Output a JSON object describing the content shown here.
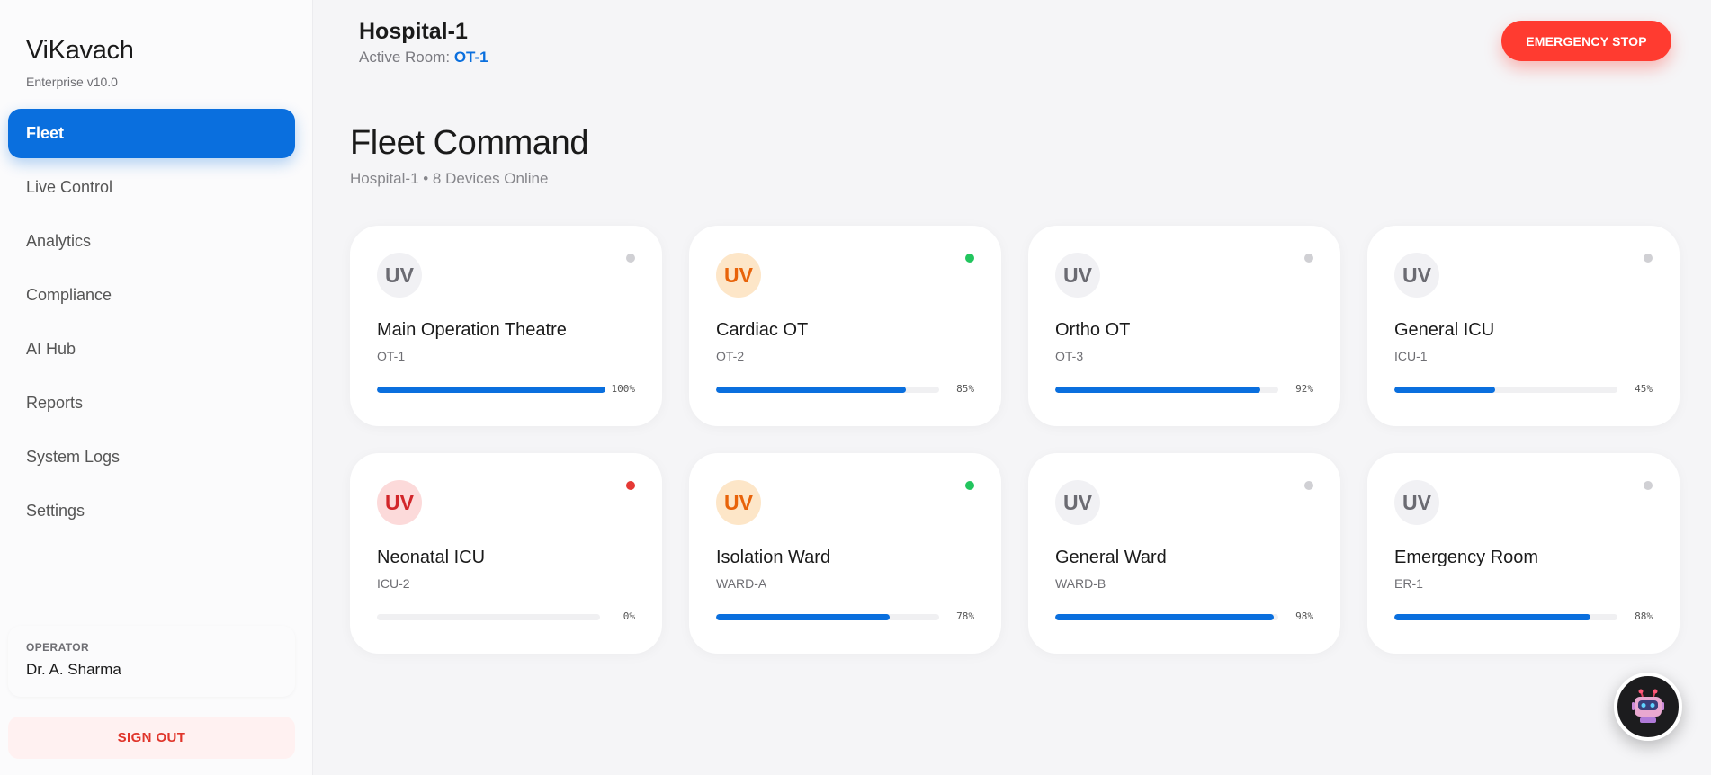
{
  "brand": {
    "title": "ViKavach",
    "subtitle": "Enterprise v10.0"
  },
  "nav": [
    {
      "label": "Fleet",
      "active": true
    },
    {
      "label": "Live Control"
    },
    {
      "label": "Analytics"
    },
    {
      "label": "Compliance"
    },
    {
      "label": "AI Hub"
    },
    {
      "label": "Reports"
    },
    {
      "label": "System Logs"
    },
    {
      "label": "Settings"
    }
  ],
  "operator": {
    "label": "OPERATOR",
    "name": "Dr. A. Sharma"
  },
  "sign_out": "SIGN OUT",
  "header": {
    "title": "Hospital-1",
    "active_room_label": "Active Room:",
    "active_room": "OT-1",
    "emergency_stop": "EMERGENCY STOP"
  },
  "page": {
    "title": "Fleet Command",
    "subtitle": "Hospital-1 • 8 Devices Online"
  },
  "colors": {
    "accent": "#0a6fde",
    "danger": "#ff3b30",
    "ok": "#22c55e"
  },
  "devices": [
    {
      "badge": "UV",
      "badge_state": "neutral",
      "status": "idle",
      "name": "Main Operation Theatre",
      "code": "OT-1",
      "progress": 100,
      "progress_label": "100%"
    },
    {
      "badge": "UV",
      "badge_state": "warn",
      "status": "online",
      "name": "Cardiac OT",
      "code": "OT-2",
      "progress": 85,
      "progress_label": "85%"
    },
    {
      "badge": "UV",
      "badge_state": "neutral",
      "status": "idle",
      "name": "Ortho OT",
      "code": "OT-3",
      "progress": 92,
      "progress_label": "92%"
    },
    {
      "badge": "UV",
      "badge_state": "neutral",
      "status": "idle",
      "name": "General ICU",
      "code": "ICU-1",
      "progress": 45,
      "progress_label": "45%"
    },
    {
      "badge": "UV",
      "badge_state": "err",
      "status": "error",
      "name": "Neonatal ICU",
      "code": "ICU-2",
      "progress": 0,
      "progress_label": "0%"
    },
    {
      "badge": "UV",
      "badge_state": "warn",
      "status": "online",
      "name": "Isolation Ward",
      "code": "WARD-A",
      "progress": 78,
      "progress_label": "78%"
    },
    {
      "badge": "UV",
      "badge_state": "neutral",
      "status": "idle",
      "name": "General Ward",
      "code": "WARD-B",
      "progress": 98,
      "progress_label": "98%"
    },
    {
      "badge": "UV",
      "badge_state": "neutral",
      "status": "idle",
      "name": "Emergency Room",
      "code": "ER-1",
      "progress": 88,
      "progress_label": "88%"
    }
  ],
  "assistant": {
    "icon": "robot-icon"
  }
}
